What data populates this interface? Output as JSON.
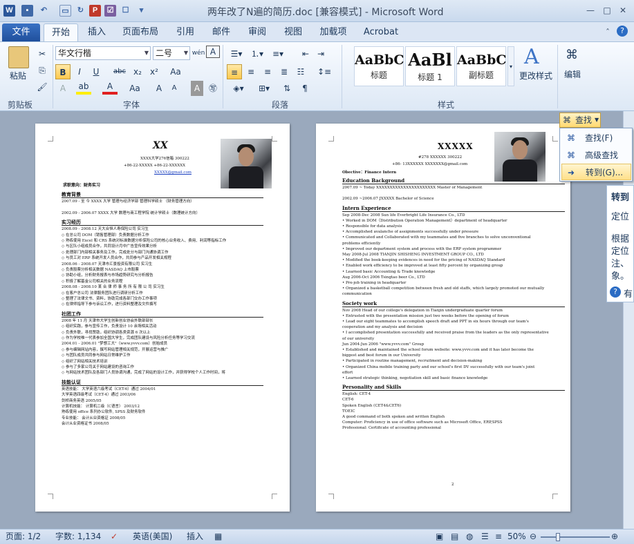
{
  "window": {
    "title": "两年改了N遍的简历.doc [兼容模式] - Microsoft Word",
    "app_icon": "W",
    "qat_icons": [
      "save-icon",
      "undo-icon",
      "redo-icon",
      "print-preview-icon",
      "p-icon",
      "checklist-icon",
      "dropdown-icon"
    ]
  },
  "tabs": [
    "文件",
    "开始",
    "插入",
    "页面布局",
    "引用",
    "邮件",
    "审阅",
    "视图",
    "加载项",
    "Acrobat"
  ],
  "ribbon": {
    "clipboard": {
      "paste": "粘贴",
      "label": "剪贴板"
    },
    "font": {
      "name": "华文行楷",
      "size": "二号",
      "label": "字体",
      "buttons": [
        "B",
        "I",
        "U",
        "abc",
        "x₂",
        "x²",
        "Aa",
        "A",
        "Aa",
        "A",
        "A"
      ]
    },
    "paragraph": {
      "label": "段落"
    },
    "styles": {
      "label": "样式",
      "items": [
        {
          "sample": "AaBbC",
          "caption": "标题"
        },
        {
          "sample": "AaBl",
          "caption": "标题 1"
        },
        {
          "sample": "AaBbC",
          "caption": "副标题"
        }
      ],
      "change_styles": "更改样式"
    },
    "editing": {
      "label": "编辑"
    }
  },
  "find_menu": {
    "button": "查找",
    "items": [
      "查找(F)",
      "高级查找(A)...",
      "转到(G)..."
    ]
  },
  "side_pane": {
    "lines": [
      "转到",
      "定位",
      "根据",
      "定位",
      "注、",
      "象。",
      "有"
    ]
  },
  "page1": {
    "name": "XX",
    "addr": "XXXX大学276信箱          300222",
    "phone": "+86-22-XXXXX    +86-22-XXXXXX",
    "email": "XXXXX@gmail.com",
    "objective": "求职意向：财务实习",
    "sections": [
      {
        "h": "教育背景",
        "lines": [
          "2007.09 - 至 今     XXXX 大学 管理与经济学部 管理科学硕士 （财务管理方向）",
          "",
          "2002.09 - 2006.07   XXXX 大学 数理与商工程学院 统计学硕士（数理统计方向）"
        ]
      },
      {
        "h": "实习经历",
        "lines": [
          "2008.09 - 2008.12     天大合恒人寿保险公司                                    实习生",
          "  ◇  在总公司 DOM（销售管理部）负责数据分析工作",
          "  ◇  熟练使用 Excel 和 CRS 系统对标准数据分析保险公司的核心业务收入、费用、利润等指标工作",
          "  ◇  与区队小组成员合作，共同设计月中广告宣传效果分析",
          "  ◇  处理部门内部相关事务及工作，完成处分与部门沟通协调工作",
          "  ◇  与员工对 ERP 系统开发人员合作，共同参与产品开发相关规程",
          "2008.06 - 2008.07     天津市汇景投资有限公司                                       实习生",
          "  ◇  负责股票分析相关数据 NASDAQ 上市股票",
          "  ◇  协助小组，分析财务报表与市场趋势研究与分析报告",
          "  ◇  积极了解基金公司相关的业务流程",
          "2008.08 - 2008.10     某 合 律 师 事 务 所 有 限 公 司                                   实习生",
          "  ◇  在客户总公司 法律服务团队进行调研分析工作",
          "  ◇  整理了法律文书、资料，协助完成各部门交办工作事项",
          "  ◇  在律师指导下参与诉讼工作，进行资料整理及文件撰写"
        ]
      },
      {
        "h": "社团工作",
        "lines": [
          "2008 年 11 月    天津市大学生创新创业协会外联部部长",
          "  ◇  组织实践，参与宣传工作，负责设计 10 余场相关活动",
          "  ◇  负责外联，寻找赞助，组织协调各类资源 6 次以上",
          "  ◇  作为学校唯一代表参加全国大学生，完成团队建设与风险分析任务等学习交流",
          "2004.01 - 2006.01   \"梦想工大\"（www.yvvv.com）创始成员",
          "  ◇  参与编辑网站内容，撰写网站管理相关规范，开展运营与推广",
          "  ◇  与团队成员共同参与网站日常维护工作",
          "  ◇  组织了网站相关技术培训",
          "  ◇  参与了多家公司关于网站建设的咨询工作",
          "  ◇  与网站技术团队及各部门人员协调沟通，完成了网站的设计工作，并获得学校个人工作时间，将"
        ]
      },
      {
        "h": "技能认证",
        "lines": [
          "英语技能：    大学英语六级考试（CET-6）通过                      2004/01",
          "                  大学英语四级考试（CET-4）通过                      2003/06",
          "                  剑桥商务英语                                             2005/05",
          "计算机技能：    计算机二级（C语言）                                    2003/12",
          "                  熟练使用 office 系列办公软件, SPSS 及财务软件",
          "专业技能：    会计从业资格证                                           2008/05",
          "                  会计从业资格证书                                        2008/05"
        ]
      }
    ]
  },
  "page2": {
    "name": "XXXXX",
    "addr": "#278 XXXXXX            300222",
    "phone": "+86- 13XXXXXX       XXXXXXX@gmail.com",
    "objective": "Obective：Finance Intern",
    "sections": [
      {
        "h": "Education Background",
        "lines": [
          "2007.09 ~ Today   XXXXXXXXXXXXXXXXXXXXXX          Master of Management",
          "",
          "2002.09 ~2006.07  JXXXXX                                        Bachelor of Science"
        ]
      },
      {
        "h": "Intern Experience",
        "lines": [
          "Sep 2008-Dec 2008      Sun life Everbright Life Insurance Co., LTD",
          "   •  Worked in DOM（Distribution Operation Management）department of headquarter",
          "   •  Responsible for data analysis",
          "   •  Accomplished avalanche of assignments successfully under pressure",
          "   •  Communicated and Collaborated with my teammates and five branches to solve unconventional",
          "       problems efficiently",
          "   •  Improved our department system and process with the ERP system programmer",
          "May 2008-Jul 2008      TIANJIN SHISHENG INVESTMENT GROUP CO., LTD",
          "   •  Modified the book-keeping evidences in need for the pricing of NASDAQ Standard",
          "   •  Enabled work efficiency to be improved at least fifty percent by organizing group",
          "   •  Learned basic Accounting & Trade knowledge",
          "Aug 2006-Oct 2006      Tsingtao beer Co., LTD",
          "   •  Pre-job training in headquarter",
          "   •  Organized a basketball competition between fresh and old staffs, which largely promoted our mutually",
          "       communication"
        ]
      },
      {
        "h": "Society work",
        "lines": [
          "Nov 2008      Head of our college's delegation in Tianjin undergraduate quarter forum",
          "   •  Entrusted with the presentation mission just two weeks before the opening of forum",
          "   •  Lead our eight teammates to accomplish speech draft and PPT in six hours through our team's",
          "       cooperation and my analysis and decision",
          "   •  I accomplished presentation successfully and received praise from the leaders as the only representative",
          "       of our university",
          "Jun 2004-Jun 2006      \"www.yvvv.com\" Group",
          "   •  Established and maintained the school forum website: www.yvvv.com and it has later become the",
          "       biggest and best forum in our University",
          "   •  Participated in routine management, recruitment and decision-making",
          "   •  Organized China mobile training party and our school's first DV successfully with our team's joint",
          "       effort",
          "   •  Learned strategic thinking, negotiation skill and basic finance knowledge"
        ]
      },
      {
        "h": "Personality and Skills",
        "lines": [
          "English:        CET-4",
          "                    CET-6",
          "                    Spoken English (CET4&CET6)",
          "                    TOEIC",
          "                    A good command of both spoken and written English",
          "Computer:     Proficiency in use of office software such as Microsoft Office, ERP,SPSS",
          "Professional:  Certificate of accounting professional"
        ]
      }
    ],
    "page_no": "2"
  },
  "status": {
    "page": "页面: 1/2",
    "words": "字数: 1,134",
    "lang": "英语(美国)",
    "mode": "插入",
    "zoom": "50%",
    "zoom_level_percent": 50
  },
  "colors": {
    "file_tab": "#2b579a",
    "accent": "#ffd970"
  }
}
